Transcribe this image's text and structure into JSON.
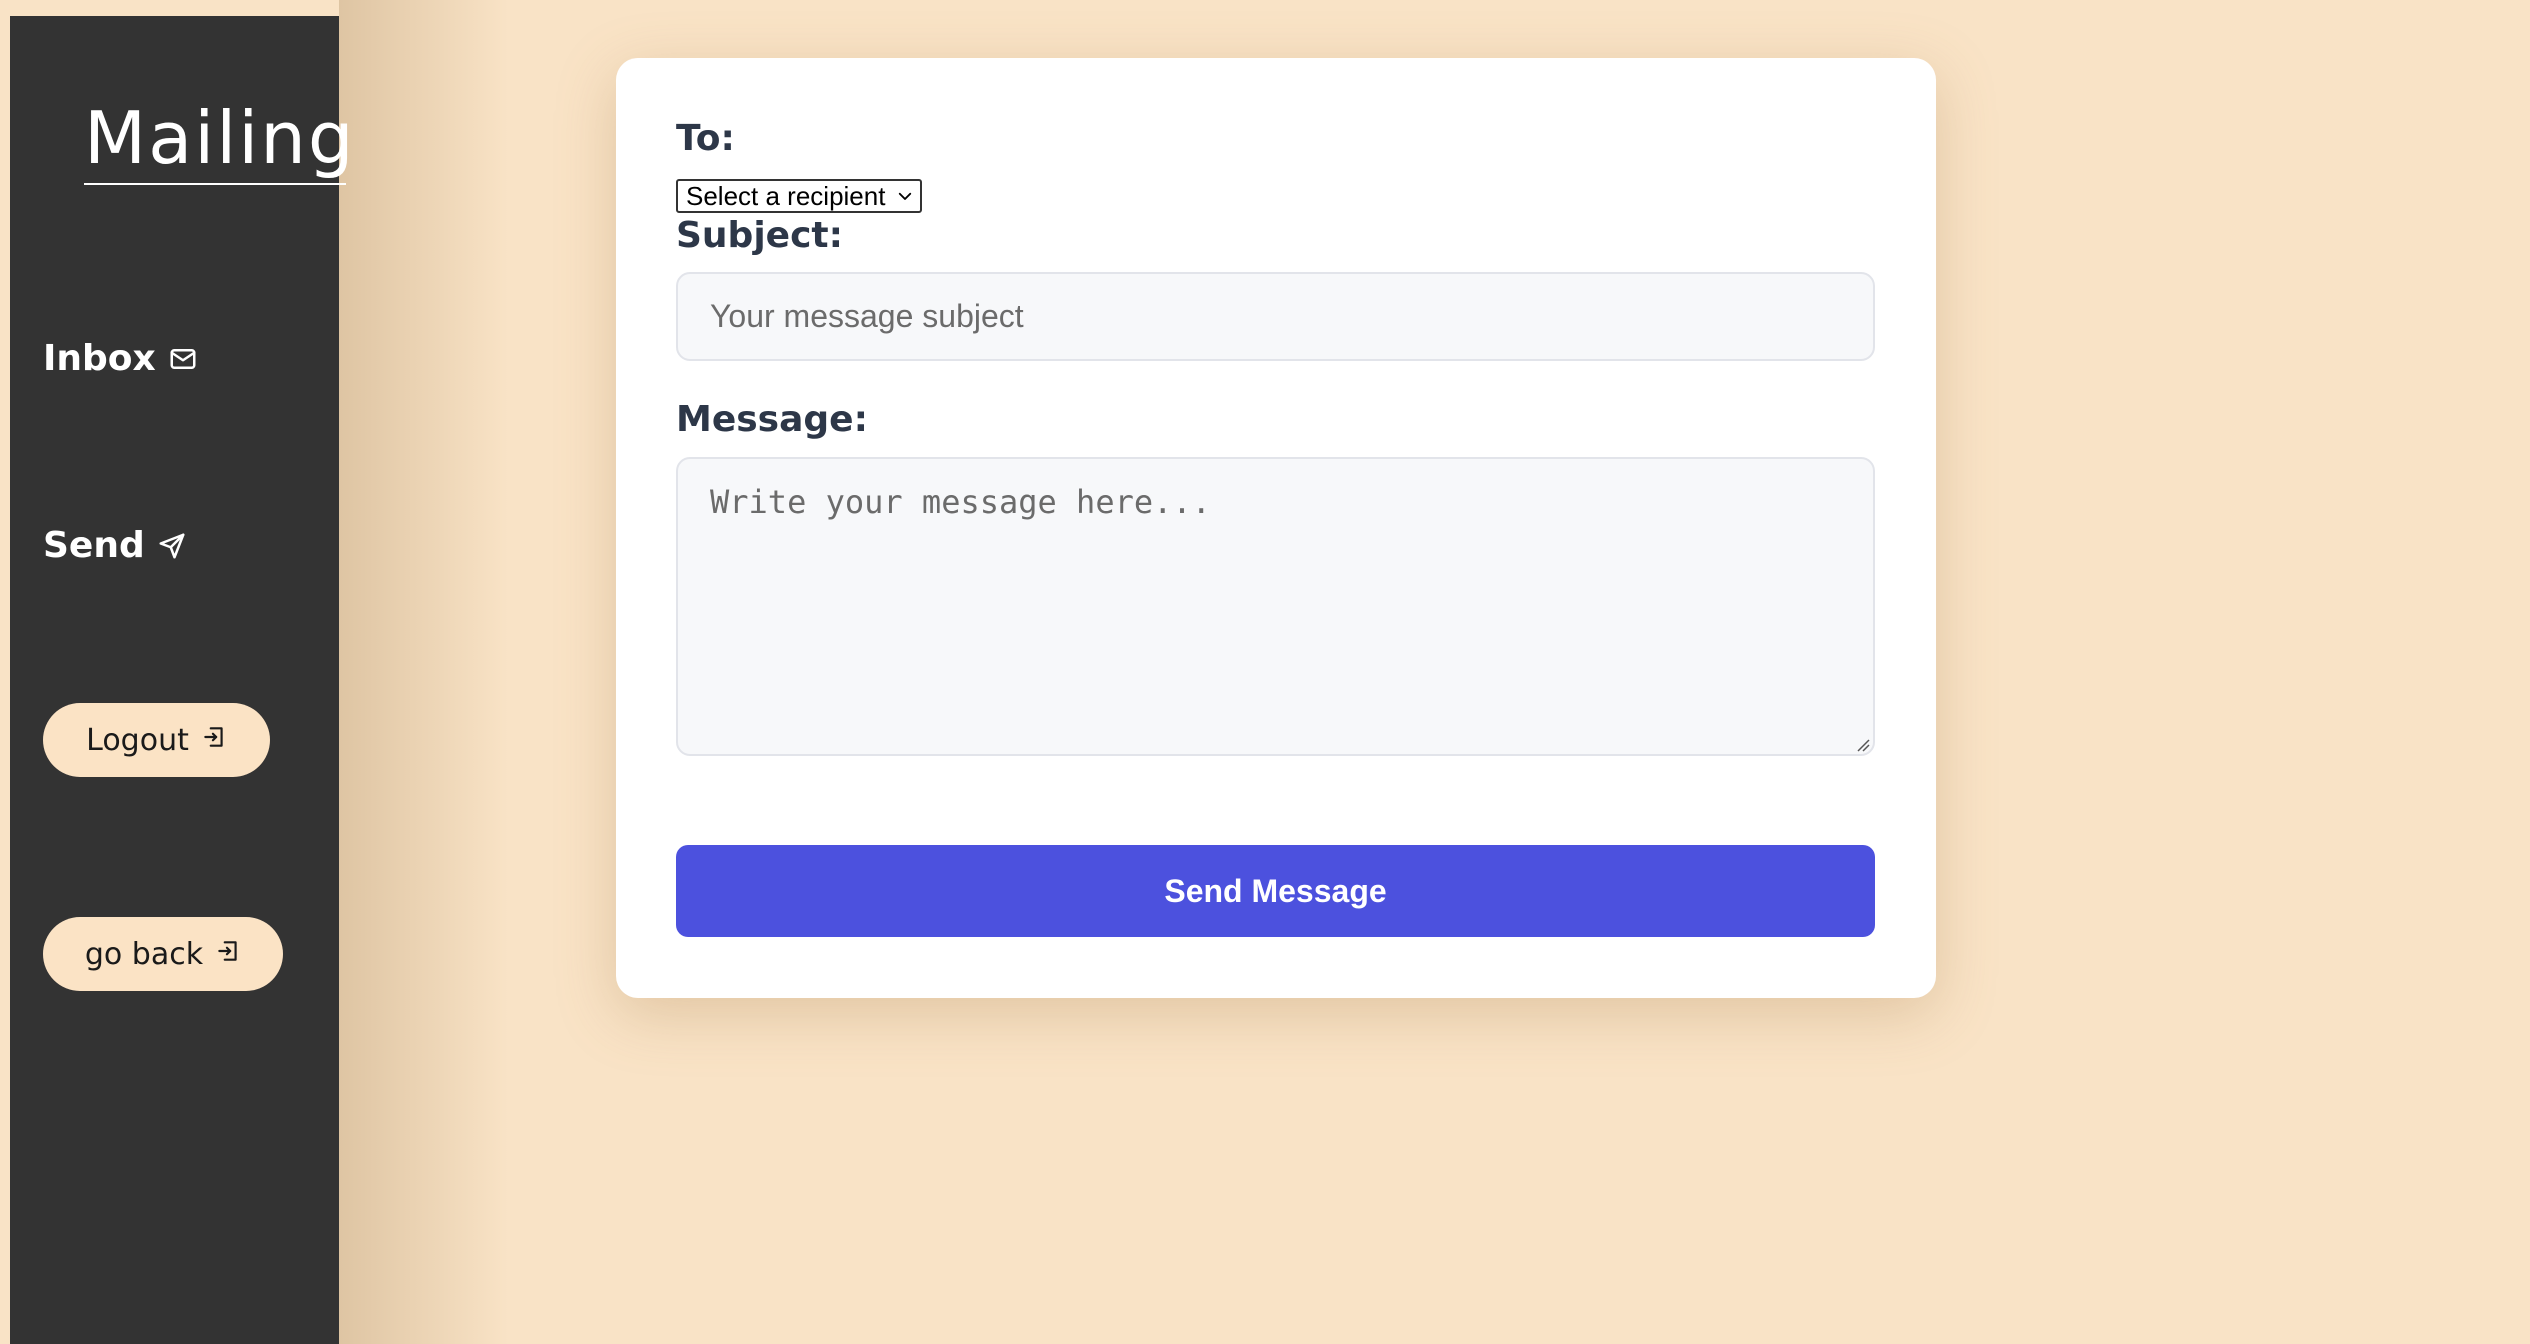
{
  "sidebar": {
    "brand": "Mailing",
    "nav": [
      {
        "label": "Inbox",
        "icon": "mail-icon"
      },
      {
        "label": "Send",
        "icon": "send-icon"
      }
    ],
    "logout_label": "Logout",
    "go_back_label": "go back"
  },
  "form": {
    "to_label": "To:",
    "recipient_selected": "Select a recipient",
    "subject_label": "Subject:",
    "subject_placeholder": "Your message subject",
    "message_label": "Message:",
    "message_placeholder": "Write your message here...",
    "send_label": "Send Message"
  },
  "colors": {
    "background": "#f9e3c6",
    "sidebar": "#333333",
    "pill": "#fbe3c5",
    "accent": "#4c51de",
    "label": "#2d3748"
  }
}
